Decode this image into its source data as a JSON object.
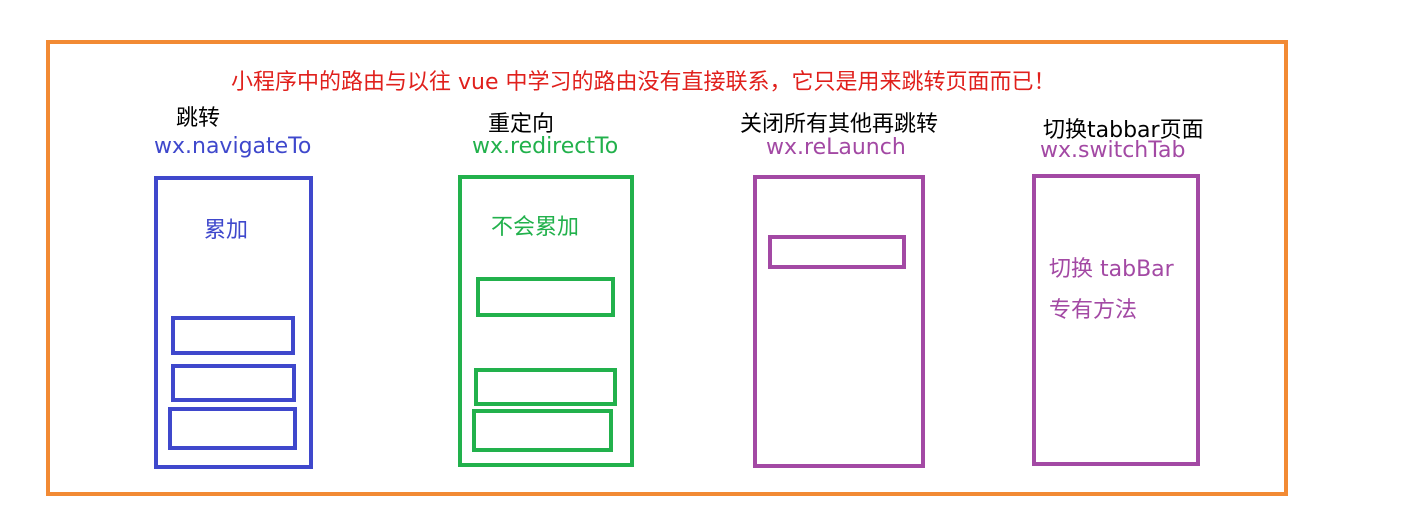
{
  "title": "小程序中的路由与以往 vue 中学习的路由没有直接联系，它只是用来跳转页面而已！",
  "columns": [
    {
      "label": "跳转",
      "api": "wx.navigateTo",
      "note": "累加",
      "color": "#3f48cc"
    },
    {
      "label": "重定向",
      "api": "wx.redirectTo",
      "note": "不会累加",
      "color": "#22b14c"
    },
    {
      "label": "关闭所有其他再跳转",
      "api": "wx.reLaunch",
      "color": "#a349a4"
    },
    {
      "label": "切换tabbar页面",
      "api": "wx.switchTab",
      "note_line1": "切换 tabBar",
      "note_line2": "专有方法",
      "color": "#a349a4"
    }
  ],
  "colors": {
    "frame": "#f28a34",
    "title": "#e0201c"
  }
}
